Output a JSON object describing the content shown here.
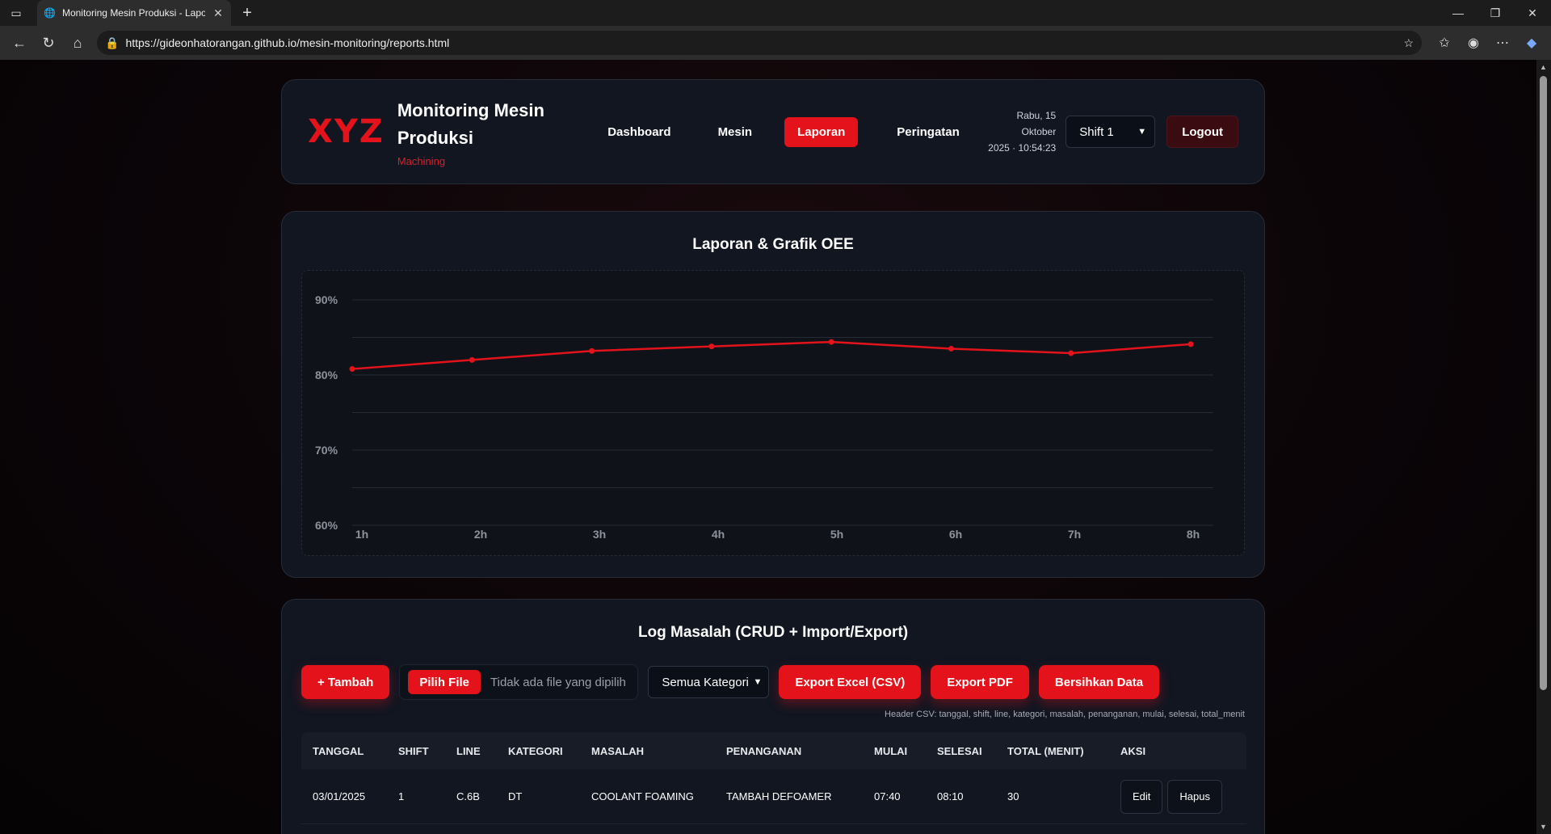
{
  "browser": {
    "tab_title": "Monitoring Mesin Produksi - Laporan",
    "url": "https://gideonhatorangan.github.io/mesin-monitoring/reports.html"
  },
  "header": {
    "logo": "XYZ",
    "title_line1": "Monitoring Mesin",
    "title_line2": "Produksi",
    "subtitle": "Machining",
    "nav": [
      "Dashboard",
      "Mesin",
      "Laporan",
      "Peringatan"
    ],
    "active_nav": "Laporan",
    "date_line": "Rabu, 15 Oktober",
    "time_line": "2025 · 10:54:23",
    "shift_selected": "Shift 1",
    "logout_label": "Logout"
  },
  "chart_section": {
    "title": "Laporan & Grafik OEE"
  },
  "chart_data": {
    "type": "line",
    "title": "Laporan & Grafik OEE",
    "categories": [
      "1h",
      "2h",
      "3h",
      "4h",
      "5h",
      "6h",
      "7h",
      "8h"
    ],
    "series": [
      {
        "values": [
          80.8,
          82.0,
          83.2,
          83.8,
          84.4,
          83.5,
          82.9,
          84.1
        ]
      }
    ],
    "ylim": [
      60,
      90
    ],
    "yticks": [
      60,
      70,
      80,
      90
    ],
    "ytick_labels": [
      "60%",
      "70%",
      "80%",
      "90%"
    ],
    "grid": true,
    "line_color": "#e3121b"
  },
  "log_section": {
    "title": "Log Masalah (CRUD + Import/Export)",
    "add_label": "+ Tambah",
    "file_button": "Pilih File",
    "file_status": "Tidak ada file yang dipilih",
    "category_selected": "Semua Kategori",
    "export_csv": "Export Excel (CSV)",
    "export_pdf": "Export PDF",
    "clear_label": "Bersihkan Data",
    "csv_hint": "Header CSV: tanggal, shift, line, kategori, masalah, penanganan, mulai, selesai, total_menit",
    "columns": [
      "TANGGAL",
      "SHIFT",
      "LINE",
      "KATEGORI",
      "MASALAH",
      "PENANGANAN",
      "MULAI",
      "SELESAI",
      "TOTAL (MENIT)",
      "AKSI"
    ],
    "rows": [
      {
        "tanggal": "03/01/2025",
        "shift": "1",
        "line": "C.6B",
        "kategori": "DT",
        "masalah": "COOLANT FOAMING",
        "penanganan": "TAMBAH DEFOAMER",
        "mulai": "07:40",
        "selesai": "08:10",
        "total": "30",
        "edit": "Edit",
        "hapus": "Hapus"
      }
    ]
  },
  "colors": {
    "accent": "#e3121b",
    "card": "#111621"
  }
}
